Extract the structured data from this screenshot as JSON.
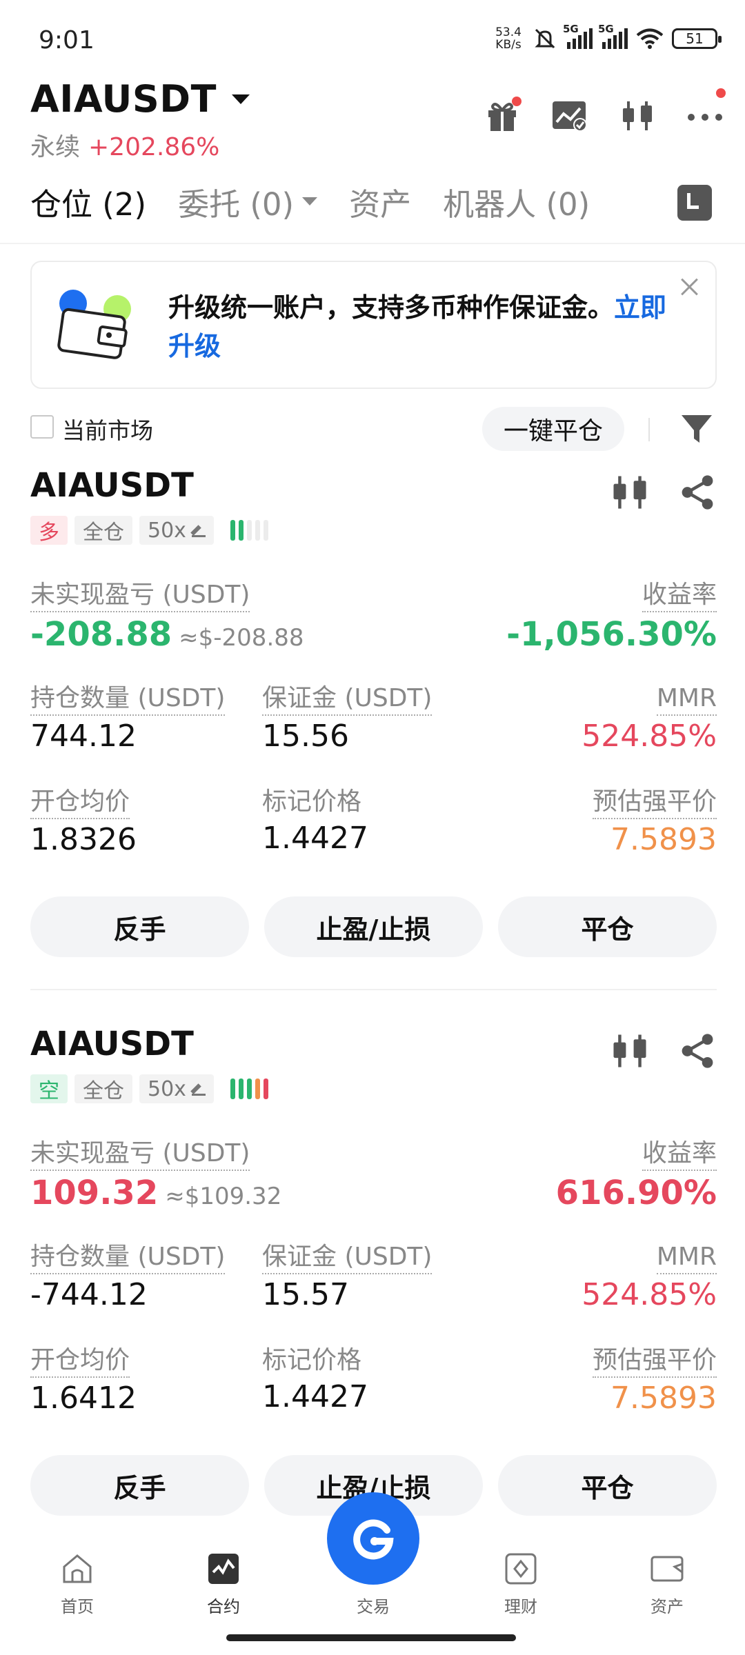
{
  "status_bar": {
    "time": "9:01",
    "net_speed_value": "53.4",
    "net_speed_unit": "KB/s",
    "signal1_label": "5G",
    "signal2_label": "5G",
    "battery": "51"
  },
  "header": {
    "pair": "AIAUSDT",
    "type": "永续",
    "change": "+202.86%"
  },
  "tabs": [
    {
      "label": "仓位 (2)",
      "active": true
    },
    {
      "label": "委托 (0)",
      "active": false
    },
    {
      "label": "资产",
      "active": false
    },
    {
      "label": "机器人 (0)",
      "active": false
    }
  ],
  "banner": {
    "text": "升级统一账户，支持多币种作保证金。",
    "link": "立即升级"
  },
  "filter": {
    "current_market_label": "当前市场",
    "close_all_label": "一键平仓"
  },
  "labels": {
    "unrealized_pnl": "未实现盈亏 (USDT)",
    "roe": "收益率",
    "position_size": "持仓数量 (USDT)",
    "margin": "保证金 (USDT)",
    "mmr": "MMR",
    "entry_price": "开仓均价",
    "mark_price": "标记价格",
    "liq_price": "预估强平价",
    "btn_reverse": "反手",
    "btn_tpsl": "止盈/止损",
    "btn_close": "平仓"
  },
  "positions": [
    {
      "symbol": "AIAUSDT",
      "side": "多",
      "margin_mode": "全仓",
      "leverage": "50x",
      "pnl": "-208.88",
      "pnl_approx": "≈$-208.88",
      "roe": "-1,056.30%",
      "size": "744.12",
      "margin": "15.56",
      "mmr": "524.85%",
      "entry_price": "1.8326",
      "mark_price": "1.4427",
      "liq_price": "7.5893",
      "risk_level": 2
    },
    {
      "symbol": "AIAUSDT",
      "side": "空",
      "margin_mode": "全仓",
      "leverage": "50x",
      "pnl": "109.32",
      "pnl_approx": "≈$109.32",
      "roe": "616.90%",
      "size": "-744.12",
      "margin": "15.57",
      "mmr": "524.85%",
      "entry_price": "1.6412",
      "mark_price": "1.4427",
      "liq_price": "7.5893",
      "risk_level": 5
    }
  ],
  "bottom_nav": {
    "home": "首页",
    "contract": "合约",
    "trade": "交易",
    "earn": "理财",
    "assets": "资产"
  },
  "colors": {
    "green": "#2bb56e",
    "red": "#e5475d",
    "orange": "#f0914a",
    "brand_blue": "#1e6ff0"
  }
}
